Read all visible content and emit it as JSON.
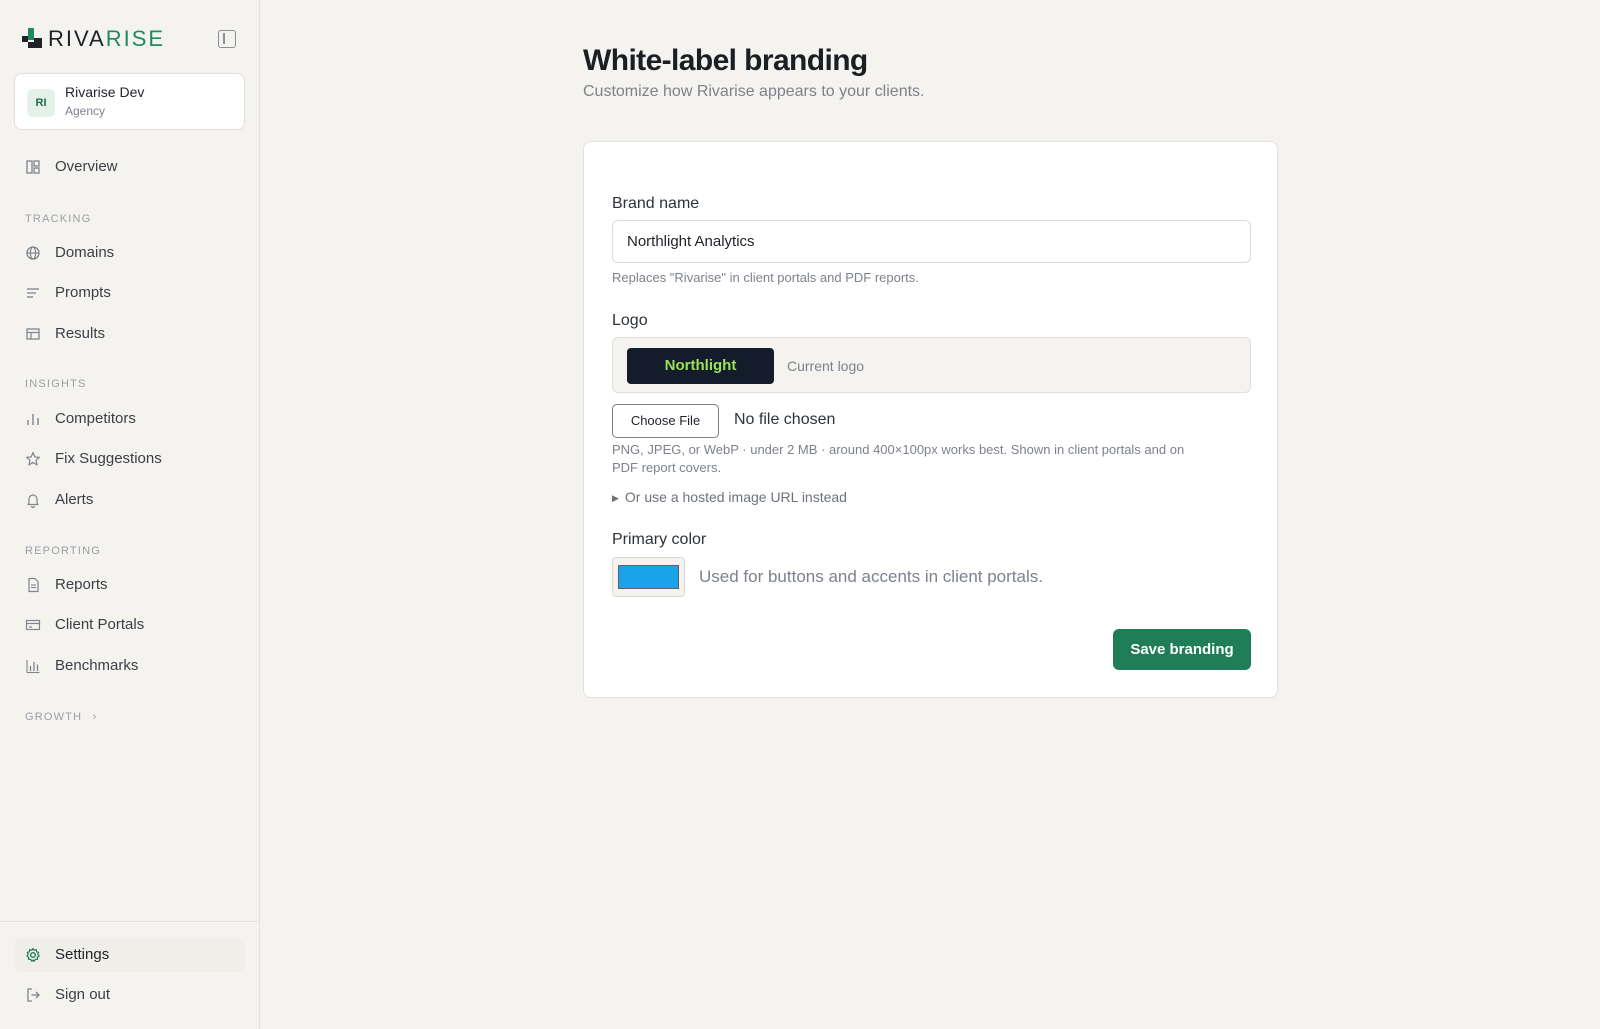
{
  "brand": {
    "name_part1": "RIVA",
    "name_part2": "RISE",
    "accent": "#1f8a5b"
  },
  "workspace": {
    "initials": "RI",
    "name": "Rivarise Dev",
    "role": "Agency"
  },
  "sidebar": {
    "overview": {
      "label": "Overview",
      "icon": "layout-grid-icon"
    },
    "sections": {
      "tracking": "TRACKING",
      "insights": "INSIGHTS",
      "reporting": "REPORTING",
      "growth": "GROWTH"
    },
    "tracking_items": [
      {
        "label": "Domains",
        "icon": "globe-icon"
      },
      {
        "label": "Prompts",
        "icon": "lines-icon"
      },
      {
        "label": "Results",
        "icon": "table-icon"
      }
    ],
    "insights_items": [
      {
        "label": "Competitors",
        "icon": "bar-chart-icon"
      },
      {
        "label": "Fix Suggestions",
        "icon": "star-icon"
      },
      {
        "label": "Alerts",
        "icon": "bell-icon"
      }
    ],
    "reporting_items": [
      {
        "label": "Reports",
        "icon": "document-icon"
      },
      {
        "label": "Client Portals",
        "icon": "card-icon"
      },
      {
        "label": "Benchmarks",
        "icon": "bar-chart-icon"
      }
    ],
    "footer": {
      "settings": {
        "label": "Settings",
        "icon": "gear-icon"
      },
      "signout": {
        "label": "Sign out",
        "icon": "sign-out-icon"
      }
    }
  },
  "page": {
    "title": "White-label branding",
    "subtitle": "Customize how Rivarise appears to your clients."
  },
  "form": {
    "brand_name": {
      "label": "Brand name",
      "value": "Northlight Analytics",
      "hint": "Replaces \"Rivarise\" in client portals and PDF reports."
    },
    "logo": {
      "label": "Logo",
      "preview_text": "Northlight",
      "caption": "Current logo",
      "choose_button": "Choose File",
      "file_status": "No file chosen",
      "hint_line1": "PNG, JPEG, or WebP · under 2 MB · around 400×100px works best. Shown in client portals and on",
      "hint_line2": "PDF report covers.",
      "url_toggle": "Or use a hosted image URL instead"
    },
    "primary_color": {
      "label": "Primary color",
      "value": "#1aa3e8",
      "caption": "Used for buttons and accents in client portals."
    },
    "save_button": "Save branding"
  }
}
